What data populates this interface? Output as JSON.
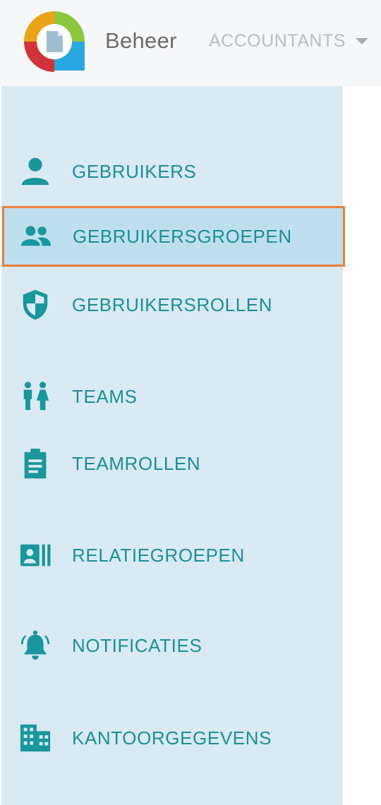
{
  "header": {
    "app_title": "Beheer",
    "org_switch_label": "ACCOUNTANTS",
    "logo_colors": [
      "#e8a317",
      "#8dc63f",
      "#28a8e0",
      "#d0343a"
    ]
  },
  "sidebar": {
    "accent_color": "#18979c",
    "active_border_color": "#e8803a",
    "items": [
      {
        "label": "GEBRUIKERS",
        "icon": "user-icon",
        "active": false
      },
      {
        "label": "GEBRUIKERSGROEPEN",
        "icon": "user-group-icon",
        "active": true
      },
      {
        "label": "GEBRUIKERSROLLEN",
        "icon": "shield-icon",
        "active": false
      },
      {
        "label": "TEAMS",
        "icon": "team-people-icon",
        "active": false
      },
      {
        "label": "TEAMROLLEN",
        "icon": "clipboard-icon",
        "active": false
      },
      {
        "label": "RELATIEGROEPEN",
        "icon": "contact-card-icon",
        "active": false
      },
      {
        "label": "NOTIFICATIES",
        "icon": "bell-icon",
        "active": false
      },
      {
        "label": "KANTOORGEGEVENS",
        "icon": "office-building-icon",
        "active": false
      }
    ]
  }
}
